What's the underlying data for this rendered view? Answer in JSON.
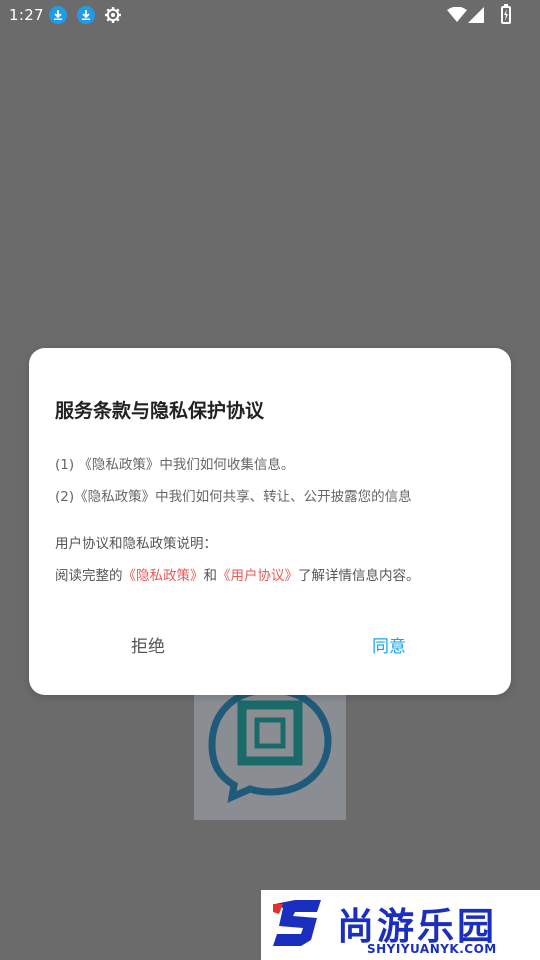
{
  "status_bar": {
    "time": "1:27",
    "icons": [
      "download-icon",
      "download-icon",
      "gear-icon",
      "wifi-icon",
      "signal-icon",
      "battery-icon"
    ]
  },
  "dialog": {
    "title": "服务条款与隐私保护协议",
    "term1": "(1) 《隐私政策》中我们如何收集信息。",
    "term2": "(2)《隐私政策》中我们如何共享、转让、公开披露您的信息",
    "note_title": "用户协议和隐私政策说明：",
    "note_prefix": "阅读完整的",
    "privacy_link": "《隐私政策》",
    "note_and": "和",
    "user_link": "《用户协议》",
    "note_suffix": "了解详情信息内容。",
    "reject_label": "拒绝",
    "agree_label": "同意"
  },
  "watermark": {
    "cn_text": "尚游乐园",
    "en_text": "SHYIYUANYK.COM"
  },
  "colors": {
    "accent": "#1aa3e8",
    "link": "#e55a5a",
    "watermark": "#1b2fbf"
  }
}
